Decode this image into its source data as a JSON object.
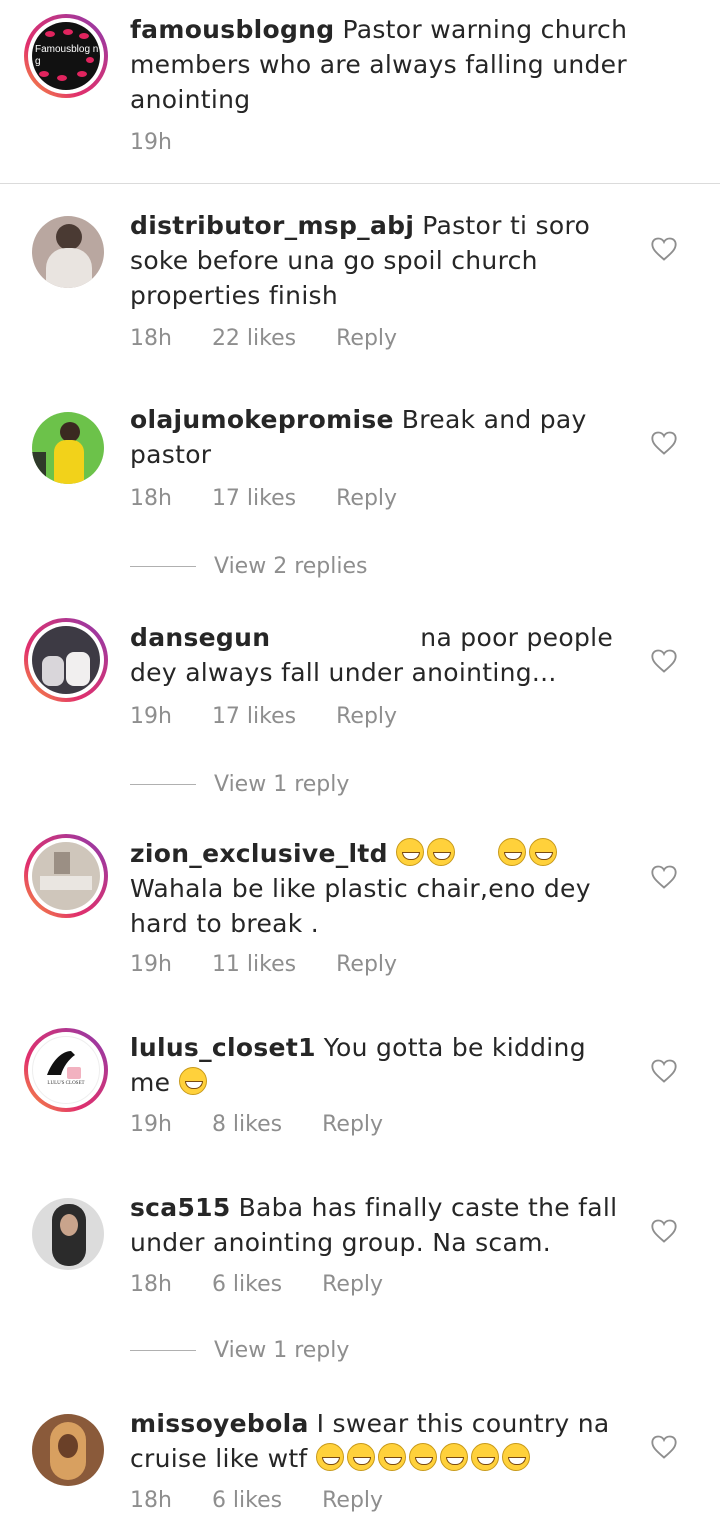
{
  "post": {
    "username": "famousblogng",
    "caption": "Pastor warning church members who are always falling under anointing",
    "time": "19h",
    "avatar_text": "Famousblog ng"
  },
  "comments": [
    {
      "username": "distributor_msp_abj",
      "text": "Pastor ti soro soke before una go spoil church properties finish",
      "time": "18h",
      "likes": "22 likes",
      "reply": "Reply",
      "avatar_color": "#b9a7a0"
    },
    {
      "username": "olajumokepromise",
      "text": "Break and pay pastor",
      "time": "18h",
      "likes": "17 likes",
      "reply": "Reply",
      "avatar_color": "#6cc24a",
      "view_replies": "View 2 replies"
    },
    {
      "username": "dansegun",
      "text": "na poor people dey always fall under anointing...",
      "time": "19h",
      "likes": "17 likes",
      "reply": "Reply",
      "avatar_color": "#3d3a44",
      "view_replies": "View 1 reply"
    },
    {
      "username": "zion_exclusive_ltd",
      "text": "Wahala be like plastic chair,eno dey hard to break .",
      "time": "19h",
      "likes": "11 likes",
      "reply": "Reply",
      "avatar_color": "#cfc6bb",
      "emoji_after_name": 4
    },
    {
      "username": "lulus_closet1",
      "text": "You gotta be kidding me",
      "time": "19h",
      "likes": "8 likes",
      "reply": "Reply",
      "avatar_color": "#ffffff",
      "emoji_after_text": 1,
      "avatar_text": "LULU'S CLOSET"
    },
    {
      "username": "sca515",
      "text": "Baba has finally caste the fall under anointing group. Na scam.",
      "time": "18h",
      "likes": "6 likes",
      "reply": "Reply",
      "avatar_color": "#2b2b2b",
      "view_replies": "View 1 reply"
    },
    {
      "username": "missoyebola",
      "text": "I swear this country na cruise like wtf",
      "time": "18h",
      "likes": "6 likes",
      "reply": "Reply",
      "avatar_color": "#8a5a3a",
      "emoji_after_text": 7
    }
  ],
  "icons": {
    "heart": "heart-outline-icon",
    "emoji": "grinning-face-icon"
  },
  "colors": {
    "ring_start": "#f9a13a",
    "ring_end": "#833ab4",
    "meta": "#8e8e8e",
    "text": "#262626"
  }
}
